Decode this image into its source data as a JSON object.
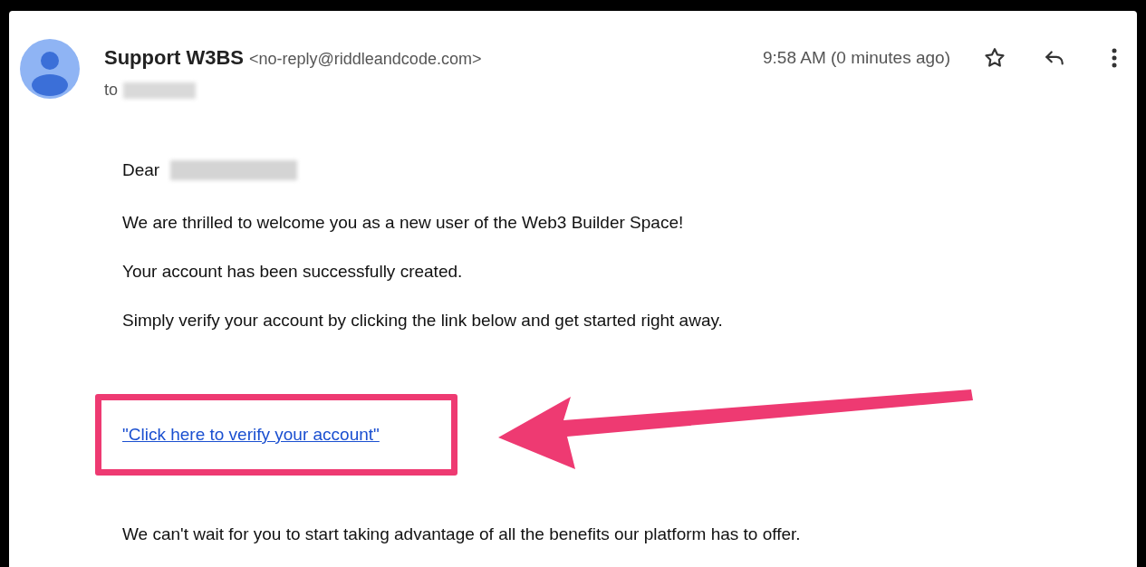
{
  "email": {
    "sender_name": "Support W3BS",
    "sender_address": "<no-reply@riddleandcode.com>",
    "to_label": "to",
    "time": "9:58 AM (0 minutes ago)",
    "greeting": "Dear",
    "paragraphs": [
      "We are thrilled to welcome you as a new user of the Web3 Builder Space!",
      "Your account has been successfully created.",
      "Simply verify your account by clicking the link below and get started right away."
    ],
    "link": "\"Click here to verify your account\"",
    "closing": "We can't wait for you to start taking advantage of all the benefits our platform has to offer."
  }
}
